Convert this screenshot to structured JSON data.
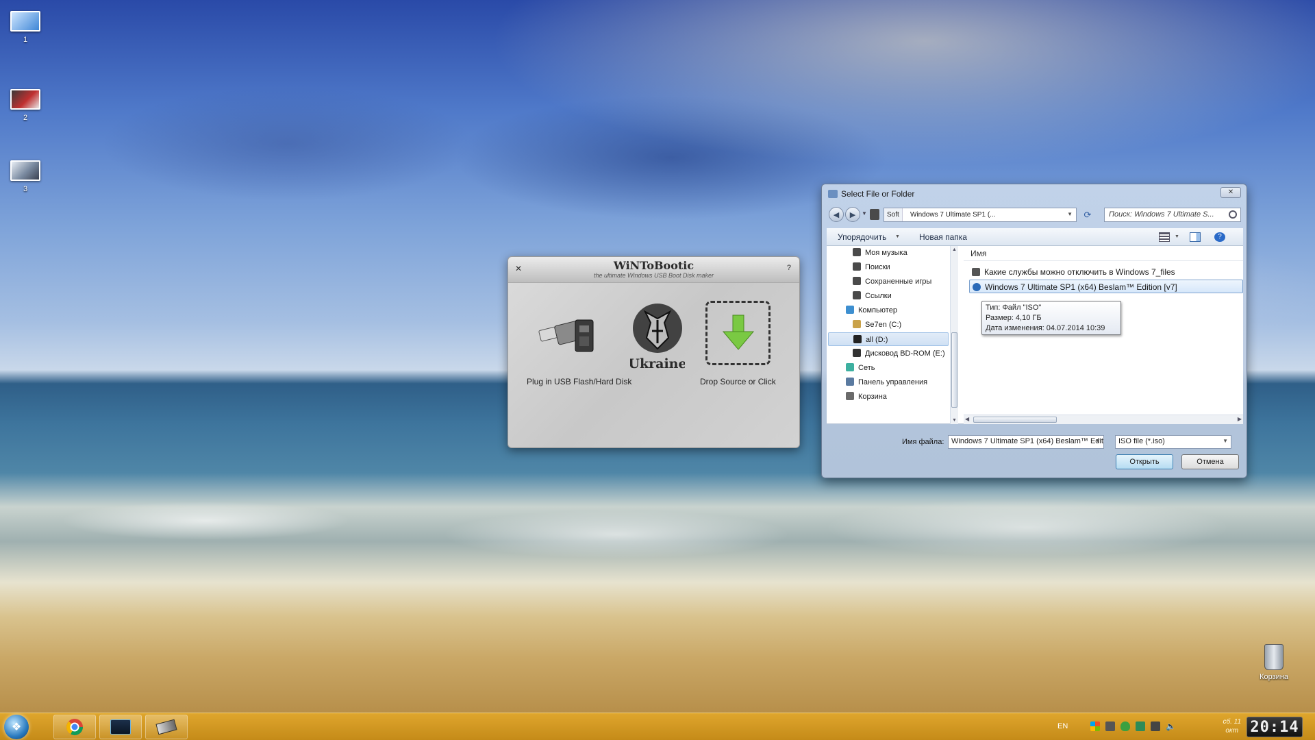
{
  "desktop": {
    "icons": [
      {
        "label": "1",
        "color": "#5aa0e0"
      },
      {
        "label": "2",
        "color": "#c03030"
      },
      {
        "label": "3",
        "color": "#7a8aa0"
      }
    ],
    "recycle_bin": "Корзина"
  },
  "wintobootic": {
    "title": "WiNToBootic",
    "subtitle": "the ultimate Windows USB Boot Disk maker",
    "usb_label": "Plug in USB Flash/Hard Disk",
    "emblem_text": "Ukraine",
    "drop_label": "Drop Source or Click"
  },
  "dialog": {
    "title": "Select File or Folder",
    "address": {
      "crumbs": [
        "Soft",
        "Windows 7 Ultimate SP1 (..."
      ]
    },
    "search_placeholder": "Поиск: Windows 7 Ultimate S...",
    "toolbar": {
      "organize": "Упорядочить",
      "new_folder": "Новая папка"
    },
    "tree": [
      {
        "label": "Моя музыка",
        "color": "#4a4a4a"
      },
      {
        "label": "Поиски",
        "color": "#4a4a4a"
      },
      {
        "label": "Сохраненные игры",
        "color": "#4a4a4a"
      },
      {
        "label": "Ссылки",
        "color": "#4a4a4a"
      },
      {
        "label": "Компьютер",
        "color": "#3d8fd0"
      },
      {
        "label": "Se7en (C:)",
        "color": "#c9a24a"
      },
      {
        "label": "all (D:)",
        "color": "#222222"
      },
      {
        "label": "Дисковод BD-ROM (E:)",
        "color": "#333333"
      },
      {
        "label": "Сеть",
        "color": "#3db0a0"
      },
      {
        "label": "Панель управления",
        "color": "#5a7aa0"
      },
      {
        "label": "Корзина",
        "color": "#6a6a6a"
      }
    ],
    "selected_tree_item": "all (D:)",
    "column_name": "Имя",
    "files": [
      {
        "name": "Какие службы можно отключить в Windows 7_files",
        "color": "#555555"
      },
      {
        "name": "Windows 7 Ultimate SP1 (x64) Beslam™ Edition [v7]",
        "color": "#2a6ab8"
      }
    ],
    "tooltip": {
      "type": "Тип: Файл \"ISO\"",
      "size": "Размер: 4,10 ГБ",
      "modified": "Дата изменения: 04.07.2014 10:39"
    },
    "filename_label": "Имя файла:",
    "filename_value": "Windows 7 Ultimate SP1 (x64) Beslam™ Edit",
    "filter_value": "ISO file (*.iso)",
    "open_button": "Открыть",
    "cancel_button": "Отмена"
  },
  "taskbar": {
    "language": "EN",
    "date_line1": "сб. 11",
    "date_line2": "окт",
    "time": "20:14"
  }
}
